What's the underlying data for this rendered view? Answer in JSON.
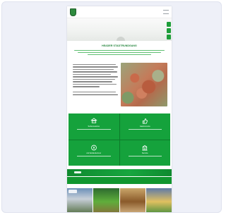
{
  "preview": {
    "page_title": "HEADER STADTRUNDGANG",
    "tiles": [
      {
        "label": "Sehenswertes",
        "icon": "landmark-icon"
      },
      {
        "label": "Gastronomie",
        "icon": "thumbs-up-icon"
      },
      {
        "label": "Auf Entdeckertour",
        "icon": "compass-icon"
      },
      {
        "label": "Service",
        "icon": "building-icon"
      }
    ]
  },
  "colors": {
    "accent": "#15a23c",
    "accent_dark": "#0d7a2a",
    "card_bg": "#eef0f8"
  }
}
